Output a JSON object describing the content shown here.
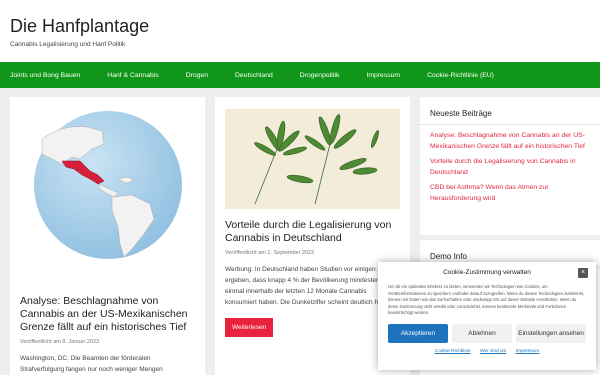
{
  "site": {
    "title": "Die Hanfplantage",
    "description": "Cannabis Legalisierung und Hanf Politik"
  },
  "nav": {
    "items": [
      "Joints und Bong Bauen",
      "Hanf & Cannabis",
      "Drogen",
      "Deutschland",
      "Drogenpolitik",
      "Impressum",
      "Cookie-Richtlinie (EU)"
    ]
  },
  "posts": [
    {
      "title": "Analyse: Beschlagnahme von Cannabis an der US-Mexikanischen Grenze fällt auf ein historisches Tief",
      "meta": "Veröffentlicht am 9. Januar 2023",
      "excerpt": "Washington, DC: Die Beamten der förderalen Strafverfolgung fangen nur noch weniger Mengen"
    },
    {
      "title": "Vorteile durch die Legalisierung von Cannabis in Deutschland",
      "meta": "Veröffentlicht am 1. September 2022",
      "excerpt": "Werbung: In Deutschland haben Studien vor einigen Jahren ergeben, dass knapp 4 % der Bevölkerung mindestens einmal innerhalb der letzten 12 Monate Cannabis konsumiert haben. Die Dunkelziffer scheint deutlich höher",
      "readmore": "Weiterlesen"
    }
  ],
  "sidebar": {
    "recent_title": "Neueste Beiträge",
    "recent": [
      "Analyse: Beschlagnahme von Cannabis an der US-Mexikanischen Grenze fällt auf ein historischen Tief",
      "Vorteile durch die Legalisierung von Cannabis in Deutschland",
      "CBD bei Asthma? Wenn das Atmen zur Herausforderung wird"
    ],
    "demo_title": "Demo Info"
  },
  "cookie": {
    "title": "Cookie-Zustimmung verwalten",
    "close": "×",
    "text": "Um dir ein optimales Erlebnis zu bieten, verwenden wir Technologien wie Cookies, um Geräteinformationen zu speichern und/oder darauf zuzugreifen. Wenn du diesen Technologien zustimmst, können wir Daten wie das Surfverhalten oder eindeutige IDs auf dieser Website verarbeiten. Wenn du deine Zustimmung nicht erteilst oder zurückziehst, können bestimmte Merkmale und Funktionen beeinträchtigt werden.",
    "accept": "Akzeptieren",
    "deny": "Ablehnen",
    "settings": "Einstellungen ansehen",
    "links": [
      "Cookie-Richtlinie",
      "Wer sind wir",
      "Impressum"
    ]
  },
  "colors": {
    "nav": "#109618",
    "accent": "#e8213c",
    "cookie_primary": "#1e73be"
  },
  "icons": {
    "close": "close-icon"
  }
}
